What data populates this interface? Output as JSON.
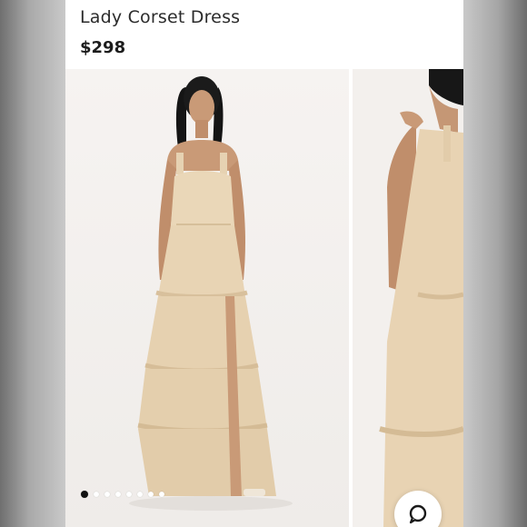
{
  "product": {
    "title": "Lady Corset Dress",
    "price": "$298"
  },
  "gallery": {
    "image_count": 8,
    "active_index": 0,
    "images": [
      {
        "name": "dress-front-photo"
      },
      {
        "name": "dress-side-photo"
      }
    ]
  },
  "chat": {
    "icon": "chat-bubble-icon"
  },
  "colors": {
    "dress": "#e9d5b6",
    "background": "#ffffff",
    "text": "#2b2b2b"
  }
}
